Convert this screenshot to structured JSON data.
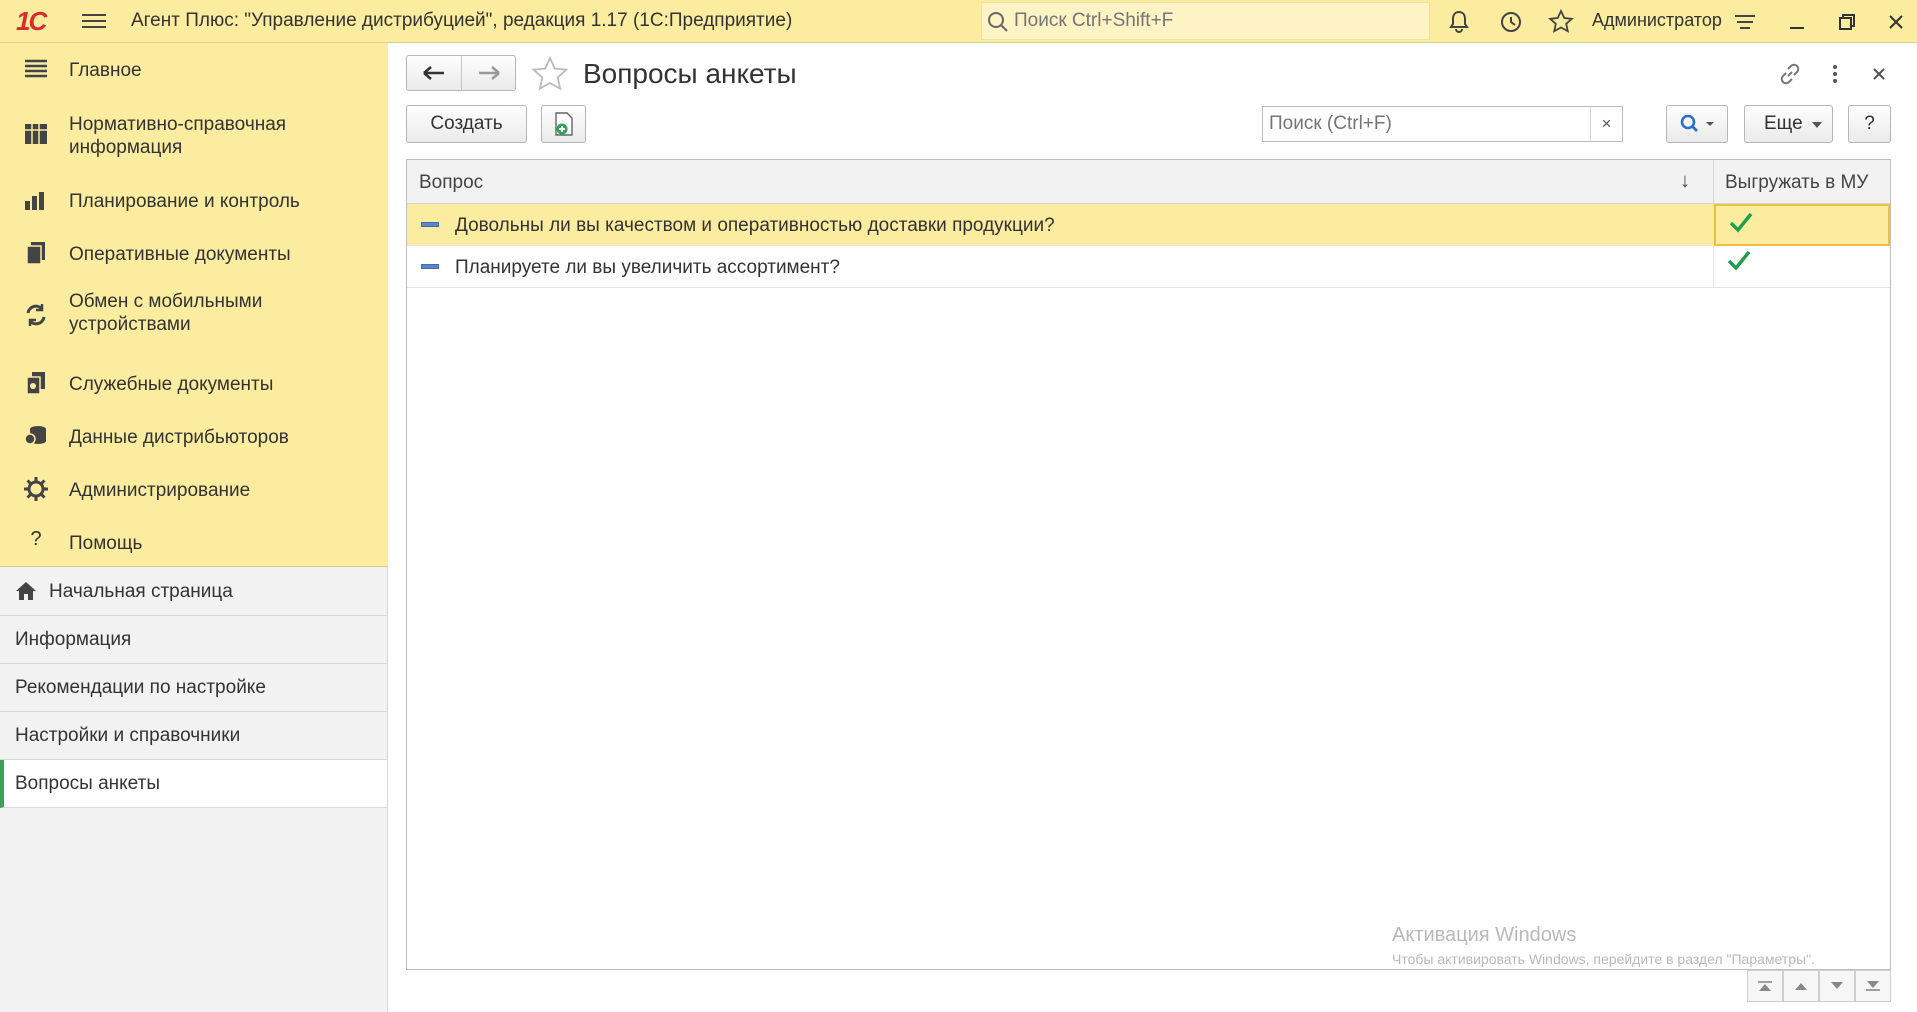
{
  "titlebar": {
    "logo": "1С",
    "app_title": "Агент Плюс: \"Управление дистрибуцией\", редакция 1.17  (1С:Предприятие)",
    "search_placeholder": "Поиск Ctrl+Shift+F",
    "user": "Администратор"
  },
  "sections": [
    {
      "label": "Главное",
      "icon": "list-icon"
    },
    {
      "label": "Нормативно-справочная информация",
      "icon": "catalog-icon"
    },
    {
      "label": "Планирование и контроль",
      "icon": "bar-chart-icon"
    },
    {
      "label": "Оперативные документы",
      "icon": "documents-icon"
    },
    {
      "label": "Обмен с мобильными устройствами",
      "icon": "sync-icon"
    },
    {
      "label": "Служебные документы",
      "icon": "service-docs-icon"
    },
    {
      "label": "Данные дистрибьюторов",
      "icon": "distributor-data-icon"
    },
    {
      "label": "Администрирование",
      "icon": "gear-icon"
    },
    {
      "label": "Помощь",
      "icon": "help-icon"
    }
  ],
  "open_windows": [
    {
      "label": "Начальная страница",
      "icon": "home-icon"
    },
    {
      "label": "Информация"
    },
    {
      "label": "Рекомендации по настройке"
    },
    {
      "label": "Настройки и справочники"
    },
    {
      "label": "Вопросы анкеты",
      "active": true
    }
  ],
  "form": {
    "title": "Вопросы анкеты",
    "create_label": "Создать",
    "search_placeholder": "Поиск (Ctrl+F)",
    "clear_label": "×",
    "more_label": "Еще",
    "help_label": "?"
  },
  "table": {
    "columns": [
      "Вопрос",
      "Выгружать в МУ"
    ],
    "sort_indicator": "↓",
    "rows": [
      {
        "question": "Довольны ли вы качеством и оперативностью доставки продукции?",
        "export_to_mu": true,
        "selected": true
      },
      {
        "question": "Планируете ли вы увеличить ассортимент?",
        "export_to_mu": true,
        "selected": false
      }
    ]
  },
  "watermark": {
    "title": "Активация Windows",
    "subtitle": "Чтобы активировать Windows, перейдите в раздел \"Параметры\"."
  },
  "colors": {
    "accent_yellow": "#fbeca0",
    "active_green": "#3aa257",
    "check_green": "#1aa048"
  }
}
